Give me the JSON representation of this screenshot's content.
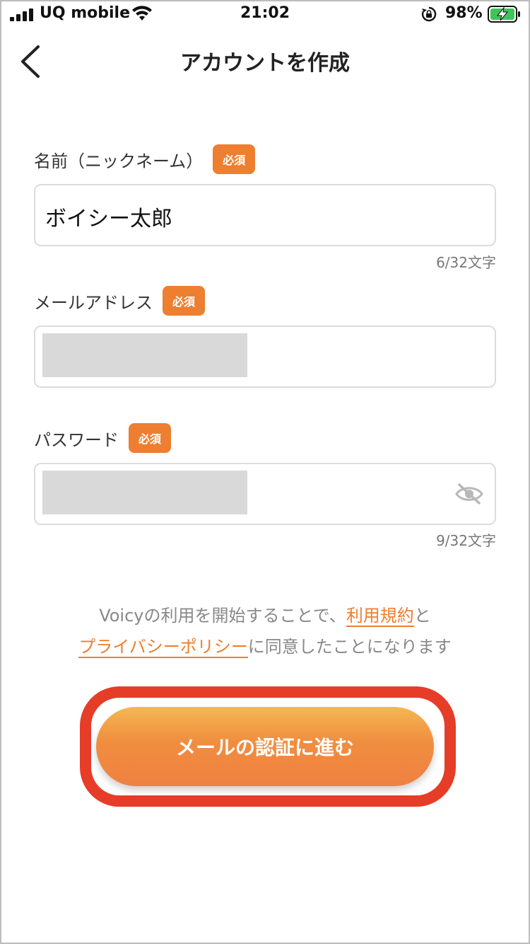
{
  "status_bar": {
    "carrier": "UQ mobile",
    "time": "21:02",
    "battery_percent": "98%"
  },
  "nav": {
    "title": "アカウントを作成"
  },
  "form": {
    "name": {
      "label": "名前（ニックネーム）",
      "required_badge": "必須",
      "value": "ボイシー太郎",
      "counter": "6/32文字"
    },
    "email": {
      "label": "メールアドレス",
      "required_badge": "必須"
    },
    "password": {
      "label": "パスワード",
      "required_badge": "必須",
      "counter": "9/32文字"
    }
  },
  "consent": {
    "prefix": "Voicyの利用を開始することで、",
    "terms_link": "利用規約",
    "and": "と",
    "privacy_link": "プライバシーポリシー",
    "suffix": "に同意したことになります"
  },
  "cta": {
    "label": "メールの認証に進む"
  },
  "colors": {
    "accent": "#ee7e30",
    "highlight": "#e63d28"
  }
}
